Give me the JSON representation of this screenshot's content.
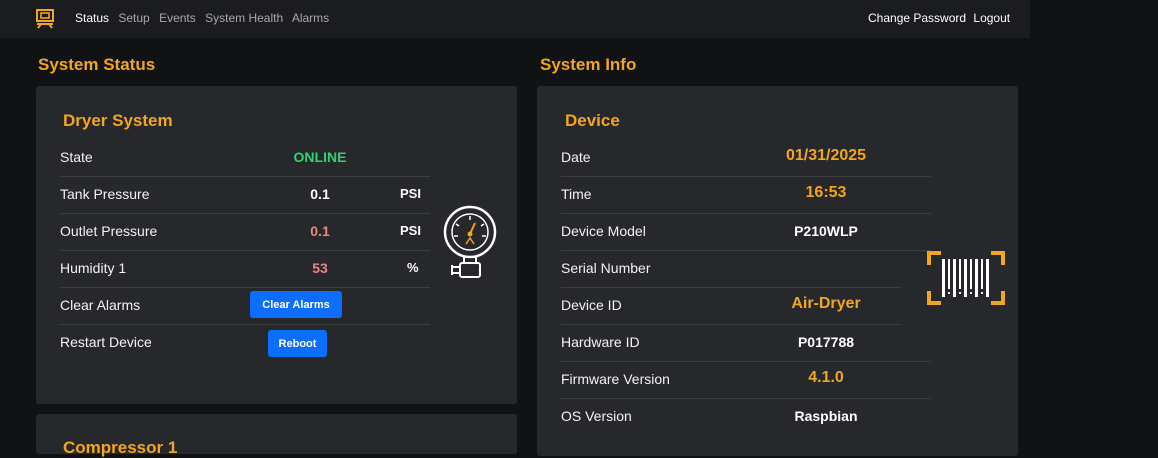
{
  "nav": {
    "items": [
      "Status",
      "Setup",
      "Events",
      "System Health",
      "Alarms"
    ],
    "account": [
      "Change Password",
      "Logout"
    ]
  },
  "system_status": {
    "title": "System Status",
    "dryer": {
      "title": "Dryer System",
      "state_label": "State",
      "state_value": "ONLINE",
      "tank_label": "Tank Pressure",
      "tank_value": "0.1",
      "tank_unit": "PSI",
      "outlet_label": "Outlet Pressure",
      "outlet_value": "0.1",
      "outlet_unit": "PSI",
      "humidity_label": "Humidity 1",
      "humidity_value": "53",
      "humidity_unit": "%",
      "clear_label": "Clear Alarms",
      "clear_button": "Clear Alarms",
      "restart_label": "Restart Device",
      "reboot_button": "Reboot"
    },
    "next_card_title": "Compressor 1"
  },
  "system_info": {
    "title": "System Info",
    "device": {
      "title": "Device",
      "rows": [
        {
          "label": "Date",
          "value": "01/31/2025",
          "color": "orange"
        },
        {
          "label": "Time",
          "value": "16:53",
          "color": "orange"
        },
        {
          "label": "Device Model",
          "value": "P210WLP",
          "color": "white"
        },
        {
          "label": "Serial Number",
          "value": "",
          "color": "white"
        },
        {
          "label": "Device ID",
          "value": "Air-Dryer",
          "color": "orange"
        },
        {
          "label": "Hardware ID",
          "value": "P017788",
          "color": "white"
        },
        {
          "label": "Firmware Version",
          "value": "4.1.0",
          "color": "orange"
        },
        {
          "label": "OS Version",
          "value": "Raspbian",
          "color": "white"
        }
      ]
    }
  },
  "colors": {
    "accent": "#f2a61f",
    "online": "#36d06f",
    "warning": "#f0847c",
    "button": "#0d6efd"
  },
  "icons": [
    "logo-icon",
    "pressure-gauge-icon",
    "barcode-scan-icon"
  ]
}
